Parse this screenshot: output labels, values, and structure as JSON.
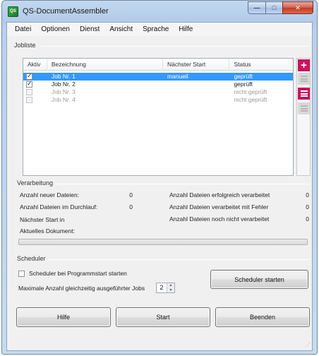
{
  "window": {
    "title": "QS-DocumentAssembler",
    "app_icon_text": "QS",
    "minimize_glyph": "—",
    "maximize_glyph": "□",
    "close_glyph": "✕"
  },
  "menu": [
    "Datei",
    "Optionen",
    "Dienst",
    "Ansicht",
    "Sprache",
    "Hilfe"
  ],
  "jobliste": {
    "label": "Jobliste",
    "columns": [
      "Aktiv",
      "Bezeichnung",
      "Nächster Start",
      "Status"
    ],
    "rows": [
      {
        "active": true,
        "enabled": true,
        "selected": true,
        "name": "Job Nr. 1",
        "next_start": "manuell",
        "status": "geprüft"
      },
      {
        "active": true,
        "enabled": true,
        "selected": false,
        "name": "Job Nr. 2",
        "next_start": "",
        "status": "geprüft"
      },
      {
        "active": false,
        "enabled": false,
        "selected": false,
        "name": "Job Nr. 3",
        "next_start": "",
        "status": "nicht geprüft"
      },
      {
        "active": false,
        "enabled": false,
        "selected": false,
        "name": "Job Nr. 4",
        "next_start": "",
        "status": "nicht geprüft"
      }
    ],
    "side_buttons": [
      "add-icon",
      "edit-icon",
      "list-icon",
      "schedule-icon"
    ],
    "add_glyph": "+"
  },
  "verarbeitung": {
    "label": "Verarbeitung",
    "neue_dateien_label": "Anzahl neuer Dateien:",
    "neue_dateien_value": "0",
    "durchlauf_label": "Anzahl Dateien im Durchlauf:",
    "durchlauf_value": "0",
    "erfolgreich_label": "Anzahl Dateien erfolgreich verarbeitet",
    "erfolgreich_value": "0",
    "fehler_label": "Anzahl Dateien verarbeitet mit Fehler",
    "fehler_value": "0",
    "nicht_verarbeitet_label": "Anzahl Dateien noch nicht verarbeitet",
    "nicht_verarbeitet_value": "0",
    "naechster_start_label": "Nächster Start in",
    "aktuelles_dokument_label": "Aktuelles Dokument:",
    "progress": 0
  },
  "scheduler": {
    "label": "Scheduler",
    "autostart_label": "Scheduler bei Programmstart starten",
    "autostart_checked": false,
    "max_jobs_label": "Maximale Anzahl gleichzeitig ausgeführter Jobs",
    "max_jobs_value": "2",
    "spin_up_glyph": "▲",
    "spin_down_glyph": "▼",
    "start_button": "Scheduler starten"
  },
  "footer": {
    "help_button": "Hilfe",
    "start_button": "Start",
    "exit_button": "Beenden",
    "grip_glyph": "⋰"
  }
}
